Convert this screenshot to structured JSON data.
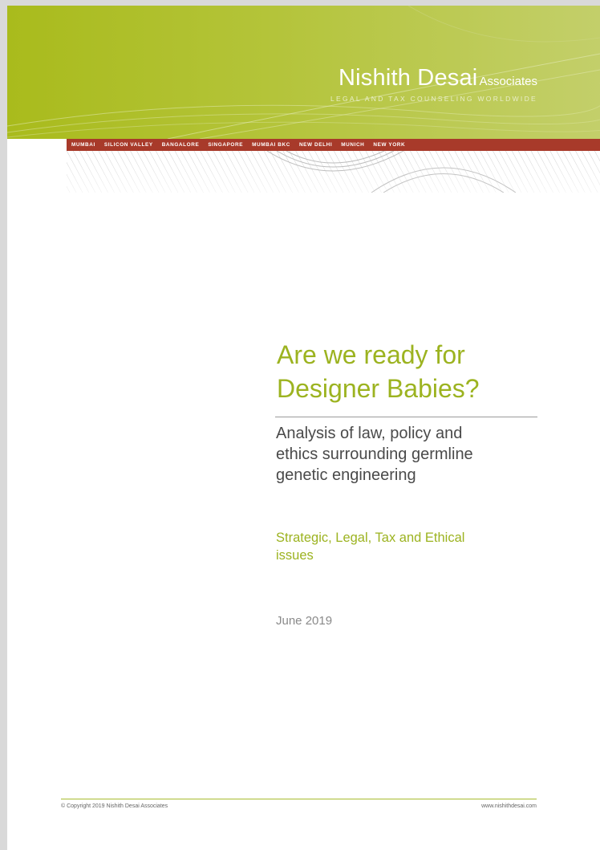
{
  "header": {
    "logo_name": "Nishith Desai",
    "logo_assoc": "Associates",
    "logo_tagline": "LEGAL AND TAX COUNSELING WORLDWIDE",
    "cities": [
      "MUMBAI",
      "SILICON VALLEY",
      "BANGALORE",
      "SINGAPORE",
      "MUMBAI BKC",
      "NEW DELHI",
      "MUNICH",
      "NEW YORK"
    ],
    "colors": {
      "band": "#a9bb1c",
      "city_bar": "#a83a2a"
    }
  },
  "cover": {
    "title_line1": "Are we ready for",
    "title_line2": "Designer Babies?",
    "subtitle_line1": "Analysis of law, policy and",
    "subtitle_line2": "ethics surrounding germline",
    "subtitle_line3": "genetic engineering",
    "topics_line1": "Strategic, Legal, Tax and Ethical",
    "topics_line2": "issues",
    "date": "June 2019",
    "accent_color": "#9cb320"
  },
  "footer": {
    "copyright": "© Copyright 2019 Nishith Desai Associates",
    "website": "www.nishithdesai.com"
  }
}
